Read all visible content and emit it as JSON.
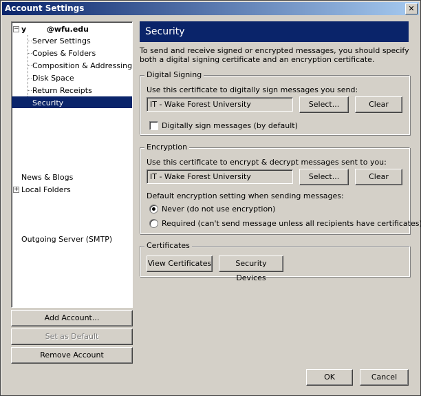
{
  "window": {
    "title": "Account Settings",
    "close_glyph": "✕"
  },
  "tree": {
    "account": {
      "expander": "−",
      "prefix": "y",
      "email": "@wfu.edu"
    },
    "children": [
      "Server Settings",
      "Copies & Folders",
      "Composition & Addressing",
      "Disk Space",
      "Return Receipts",
      "Security"
    ],
    "news": "News & Blogs",
    "local": {
      "expander": "+",
      "label": "Local Folders"
    },
    "outgoing": "Outgoing Server (SMTP)"
  },
  "left_buttons": {
    "add": "Add Account...",
    "default": "Set as Default",
    "remove": "Remove Account"
  },
  "panel": {
    "title": "Security",
    "description": "To send and receive signed or encrypted messages, you should specify both a digital signing certificate and an encryption certificate."
  },
  "signing": {
    "legend": "Digital Signing",
    "prompt": "Use this certificate to digitally sign messages you send:",
    "certificate": "IT   - Wake Forest University",
    "select": "Select...",
    "clear": "Clear",
    "checkbox_label": "Digitally sign messages (by default)"
  },
  "encryption": {
    "legend": "Encryption",
    "prompt": "Use this certificate to encrypt & decrypt messages sent to you:",
    "certificate": "IT   - Wake Forest University",
    "select": "Select...",
    "clear": "Clear",
    "default_label": "Default encryption setting when sending messages:",
    "never": "Never (do not use encryption)",
    "required": "Required (can't send message unless all recipients have certificates)"
  },
  "certificates": {
    "legend": "Certificates",
    "view": "View Certificates",
    "devices": "Security Devices"
  },
  "footer": {
    "ok": "OK",
    "cancel": "Cancel"
  }
}
